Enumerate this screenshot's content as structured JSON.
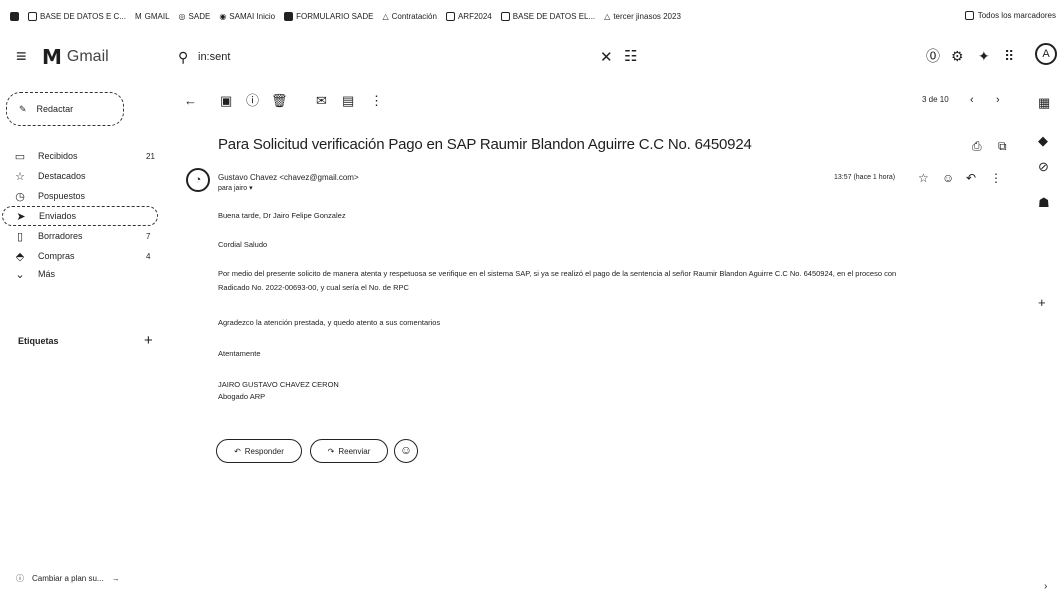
{
  "bookmarks": [
    {
      "label": "",
      "icon": "apps-icon"
    },
    {
      "label": "BASE DE DATOS E C...",
      "icon": "sheets-icon"
    },
    {
      "label": "GMAIL",
      "icon": "gmail-icon"
    },
    {
      "label": "SADE",
      "icon": "globe-icon"
    },
    {
      "label": "SAMAI Inicio",
      "icon": "globe-icon"
    },
    {
      "label": "FORMULARIO SADE",
      "icon": "forms-icon"
    },
    {
      "label": "Contratación",
      "icon": "drive-icon"
    },
    {
      "label": "ARF2024",
      "icon": "sheets-icon"
    },
    {
      "label": "BASE DE DATOS EL...",
      "icon": "sheets-icon"
    },
    {
      "label": "tercer jinasos 2023",
      "icon": "drive-icon"
    }
  ],
  "all_bookmarks": "Todos los marcadores",
  "header": {
    "logo_text": "Gmail",
    "search_value": "in:sent",
    "avatar_letter": "A"
  },
  "sidebar": {
    "compose": "Redactar",
    "items": [
      {
        "label": "Recibidos",
        "count": "21",
        "icon": "▭"
      },
      {
        "label": "Destacados",
        "count": "",
        "icon": "☆"
      },
      {
        "label": "Pospuestos",
        "count": "",
        "icon": "◷"
      },
      {
        "label": "Enviados",
        "count": "",
        "icon": "➤"
      },
      {
        "label": "Borradores",
        "count": "7",
        "icon": "▯"
      },
      {
        "label": "Compras",
        "count": "4",
        "icon": "⬘"
      },
      {
        "label": "Más",
        "count": "",
        "icon": "⌄"
      }
    ],
    "labels_title": "Etiquetas",
    "footer_text": "Cambiar a plan su..."
  },
  "toolbar": {
    "pager": "3 de 10"
  },
  "email": {
    "subject": "Para Solicitud verificación Pago en SAP Raumir Blandon Aguirre C.C No. 6450924",
    "sender": "Gustavo Chavez <chavez@gmail.com>",
    "to": "para jairo ▾",
    "time": "13:57 (hace 1 hora)",
    "body": [
      "Buena tarde, Dr Jairo Felipe Gonzalez",
      "Cordial Saludo",
      "Por medio del presente solicito de manera atenta y respetuosa se verifique en el sistema SAP, si ya se realizó el pago de la sentencia al señor Raumir Blandon Aguirre C.C No. 6450924, en el proceso con",
      "Radicado No. 2022-00693-00, y cual sería el No. de RPC",
      "Agradezco la atención prestada, y quedo atento a sus comentarios",
      "Atentamente",
      "JAIRO GUSTAVO CHAVEZ CERON",
      "Abogado ARP"
    ],
    "reply": "Responder",
    "forward": "Reenviar"
  }
}
